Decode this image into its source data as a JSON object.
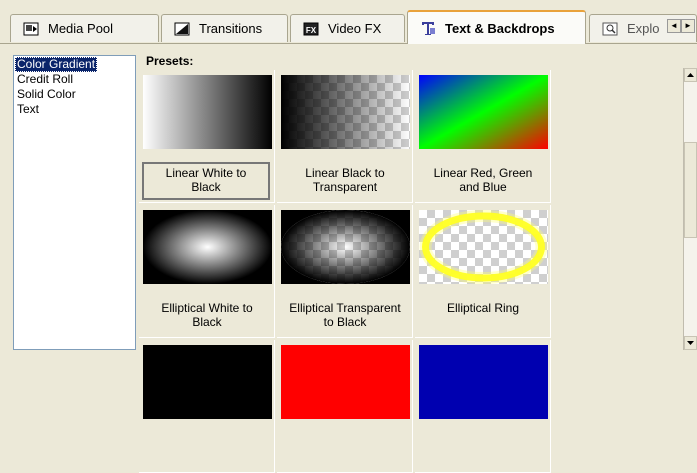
{
  "tabs": [
    {
      "label": "Media Pool",
      "icon": "media-pool-icon"
    },
    {
      "label": "Transitions",
      "icon": "transitions-icon"
    },
    {
      "label": "Video FX",
      "icon": "video-fx-icon"
    },
    {
      "label": "Text & Backdrops",
      "icon": "text-backdrops-icon",
      "active": true
    },
    {
      "label": "Explo",
      "icon": "explorer-icon"
    }
  ],
  "left_list": {
    "items": [
      "Color Gradient",
      "Credit Roll",
      "Solid Color",
      "Text"
    ],
    "selected": "Color Gradient"
  },
  "presets": {
    "label": "Presets:",
    "items": [
      {
        "caption_line1": "Linear White to",
        "caption_line2": "Black",
        "selected": true
      },
      {
        "caption_line1": "Linear Black to",
        "caption_line2": "Transparent"
      },
      {
        "caption_line1": "Linear Red, Green",
        "caption_line2": "and Blue"
      },
      {
        "caption_line1": "Elliptical White to",
        "caption_line2": "Black"
      },
      {
        "caption_line1": "Elliptical Transparent",
        "caption_line2": "to Black"
      },
      {
        "caption_line1": "Elliptical Ring",
        "caption_line2": ""
      }
    ]
  },
  "colors": {
    "selection": "#0a246a",
    "active_tab_accent": "#e9a23b",
    "ring": "#ffff00"
  }
}
